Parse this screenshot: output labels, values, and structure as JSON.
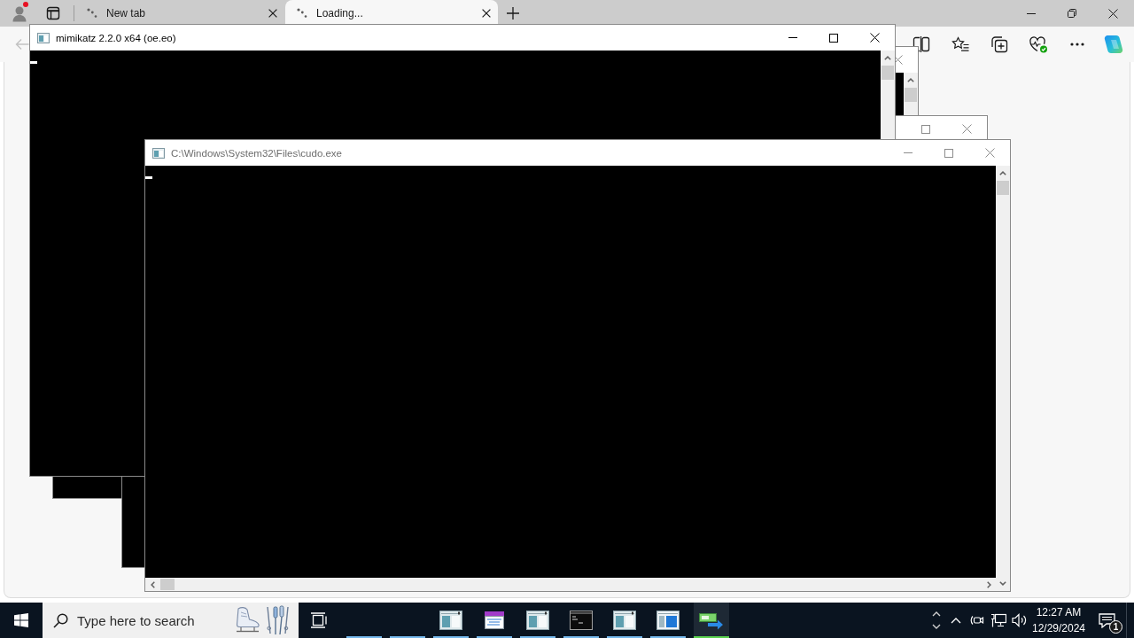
{
  "browser": {
    "profile": {
      "has_alert": true
    },
    "tabs": [
      {
        "title": "New tab",
        "selected": false
      },
      {
        "title": "Loading...",
        "selected": true
      }
    ],
    "back_button": {
      "disabled": true
    }
  },
  "windows": [
    {
      "kind": "console",
      "active": false
    },
    {
      "kind": "console",
      "active": false
    },
    {
      "kind": "console",
      "title": "mimikatz 2.2.0 x64 (oe.eo)",
      "active": true,
      "cursor": true
    },
    {
      "kind": "console",
      "title": "C:\\Windows\\System32\\Files\\cudo.exe",
      "active": false,
      "cursor": true,
      "horizontal_scrollbar": true
    }
  ],
  "taskbar": {
    "search": {
      "placeholder": "Type here to search"
    },
    "apps": [
      {
        "kind": "blank",
        "running": true,
        "selected": false
      },
      {
        "kind": "blank",
        "running": true,
        "selected": false
      },
      {
        "kind": "window",
        "running": true,
        "selected": false
      },
      {
        "kind": "form",
        "running": true,
        "selected": false
      },
      {
        "kind": "window",
        "running": true,
        "selected": false
      },
      {
        "kind": "terminal",
        "running": true,
        "selected": false
      },
      {
        "kind": "window",
        "running": true,
        "selected": false
      },
      {
        "kind": "panel",
        "running": true,
        "selected": false
      },
      {
        "kind": "transfer",
        "running": true,
        "selected": true
      }
    ],
    "clock": {
      "time": "12:27 AM",
      "date": "12/29/2024"
    },
    "notifications": {
      "count": "1"
    }
  }
}
